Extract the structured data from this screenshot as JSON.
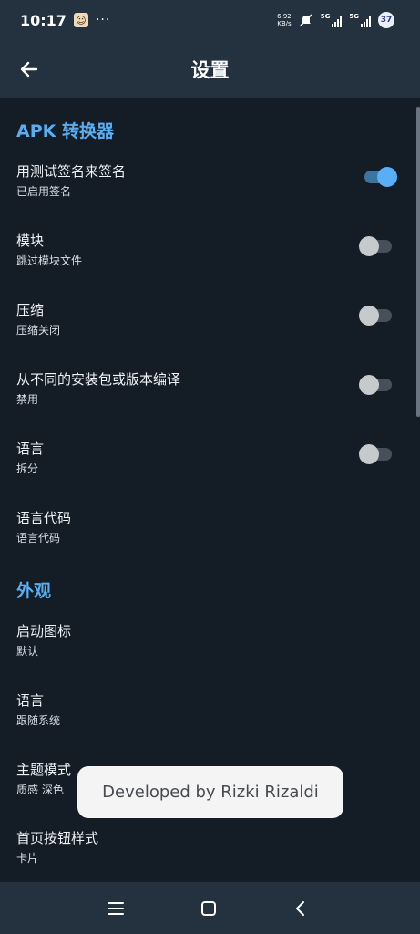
{
  "status_bar": {
    "time": "10:17",
    "overflow": "···",
    "net_speed_value": "6.92",
    "net_speed_unit": "KB/s",
    "sim1_label": "5G",
    "sim2_label": "5G",
    "battery": "37"
  },
  "app_bar": {
    "title": "设置"
  },
  "sections": [
    {
      "header": "APK 转换器"
    },
    {
      "header": "外观"
    }
  ],
  "settings": [
    {
      "title": "用测试签名来签名",
      "summary": "已启用签名",
      "toggle": true
    },
    {
      "title": "模块",
      "summary": "跳过模块文件",
      "toggle": false
    },
    {
      "title": "压缩",
      "summary": "压缩关闭",
      "toggle": false
    },
    {
      "title": "从不同的安装包或版本编译",
      "summary": "禁用",
      "toggle": false
    },
    {
      "title": "语言",
      "summary": "拆分",
      "toggle": false
    },
    {
      "title": "语言代码",
      "summary": "语言代码"
    },
    {
      "title": "启动图标",
      "summary": "默认"
    },
    {
      "title": "语言",
      "summary": "跟随系统"
    },
    {
      "title": "主题模式",
      "summary": "质感 深色"
    },
    {
      "title": "首页按钮样式",
      "summary": "卡片"
    }
  ],
  "toast": "Developed by Rizki Rizaldi",
  "icons": {
    "back": "arrow-left-icon",
    "menu": "menu-icon",
    "home": "home-icon",
    "nav_back": "chevron-left-icon"
  },
  "colors": {
    "background": "#141c26",
    "app_bar": "#243240",
    "accent": "#58aef2",
    "switch_on": "#5aaef5"
  }
}
